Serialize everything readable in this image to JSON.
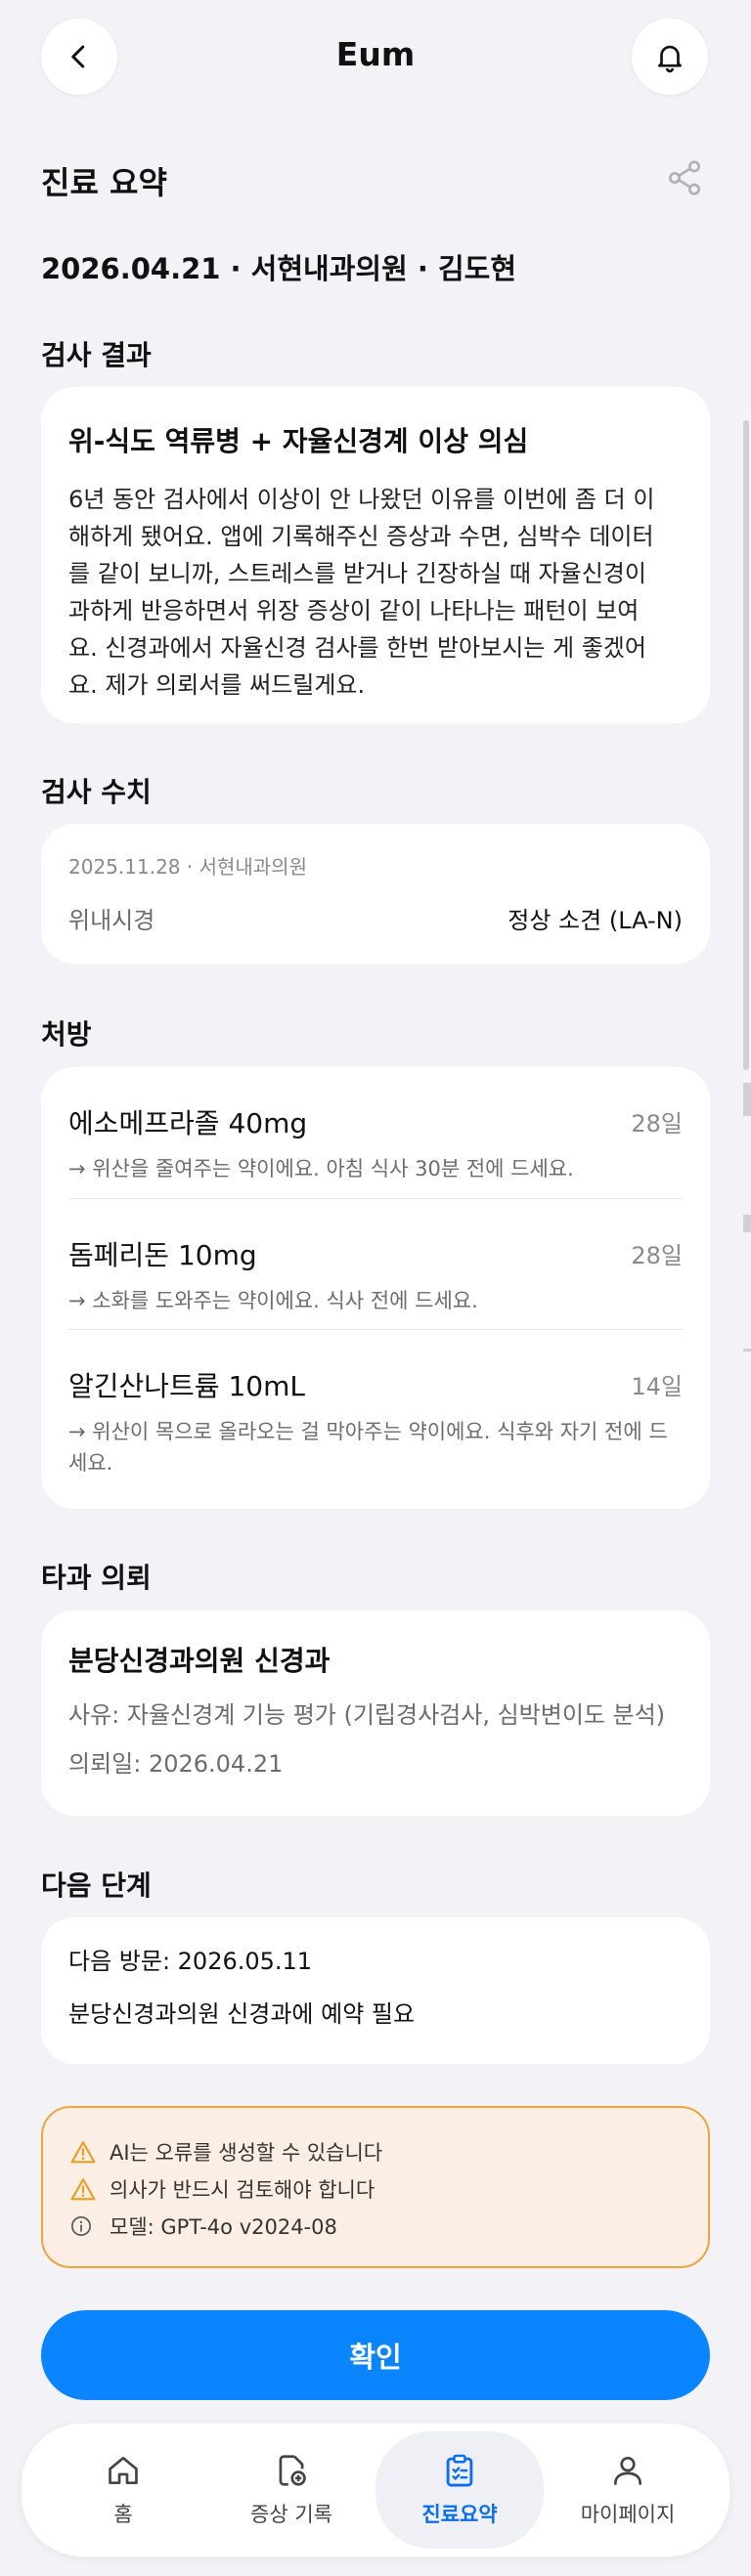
{
  "header": {
    "title": "Eum",
    "back_icon": "chevron-left-icon",
    "bell_icon": "bell-icon"
  },
  "summary": {
    "title": "진료 요약",
    "share_icon": "share-icon",
    "visit_line": "2026.04.21 · 서현내과의원 · 김도현"
  },
  "result": {
    "section": "검사 결과",
    "title": "위-식도 역류병 + 자율신경계 이상 의심",
    "lines": [
      "6년 동안 검사에서 이상이 안 나왔던 이유를 이번에 좀 더 이",
      "해하게 됐어요. 앱에 기록해주신 증상과 수면, 심박수 데이터",
      "를 같이 보니까, 스트레스를 받거나 긴장하실 때 자율신경이",
      "과하게 반응하면서 위장 증상이 같이 나타나는 패턴이 보여",
      "요. 신경과에서 자율신경 검사를 한번 받아보시는 게 좋겠어",
      "요. 제가 의뢰서를 써드릴게요."
    ]
  },
  "measures": {
    "section": "검사 수치",
    "meta": "2025.11.28 · 서현내과의원",
    "label": "위내시경",
    "value": "정상 소견 (LA-N)"
  },
  "prescriptions": {
    "section": "처방",
    "items": [
      {
        "name": "에소메프라졸 40mg",
        "days": "28일",
        "desc_lines": [
          "→ 위산을 줄여주는 약이에요. 아침 식사 30분 전에 드세요."
        ]
      },
      {
        "name": "돔페리돈 10mg",
        "days": "28일",
        "desc_lines": [
          "→ 소화를 도와주는 약이에요. 식사 전에 드세요."
        ]
      },
      {
        "name": "알긴산나트륨 10mL",
        "days": "14일",
        "desc_lines": [
          "→ 위산이 목으로 올라오는 걸 막아주는 약이에요. 식후와 자기 전에 드",
          "세요."
        ]
      }
    ]
  },
  "referral": {
    "section": "타과 의뢰",
    "name": "분당신경과의원 신경과",
    "reason": "사유: 자율신경계 기능 평가 (기립경사검사, 심박변이도 분석)",
    "date": "의뢰일: 2026.04.21"
  },
  "next_step": {
    "section": "다음 단계",
    "visit": "다음 방문: 2026.05.11",
    "note": "분당신경과의원 신경과에 예약 필요"
  },
  "notice": {
    "lines": [
      {
        "icon": "warning-icon",
        "text": "AI는 오류를 생성할 수 있습니다"
      },
      {
        "icon": "warning-icon",
        "text": "의사가 반드시 검토해야 합니다"
      },
      {
        "icon": "info-icon",
        "text": "모델: GPT-4o v2024-08"
      }
    ],
    "border_color": "#f0a53b",
    "background": "#fbeee4"
  },
  "confirm_label": "확인",
  "colors": {
    "accent": "#0a84ff",
    "active_tab": "#0a6cf0"
  },
  "tabs": [
    {
      "label": "홈",
      "icon": "home-icon",
      "active": false
    },
    {
      "label": "증상 기록",
      "icon": "add-record-icon",
      "active": false
    },
    {
      "label": "진료요약",
      "icon": "clipboard-icon",
      "active": true
    },
    {
      "label": "마이페이지",
      "icon": "user-icon",
      "active": false
    }
  ]
}
